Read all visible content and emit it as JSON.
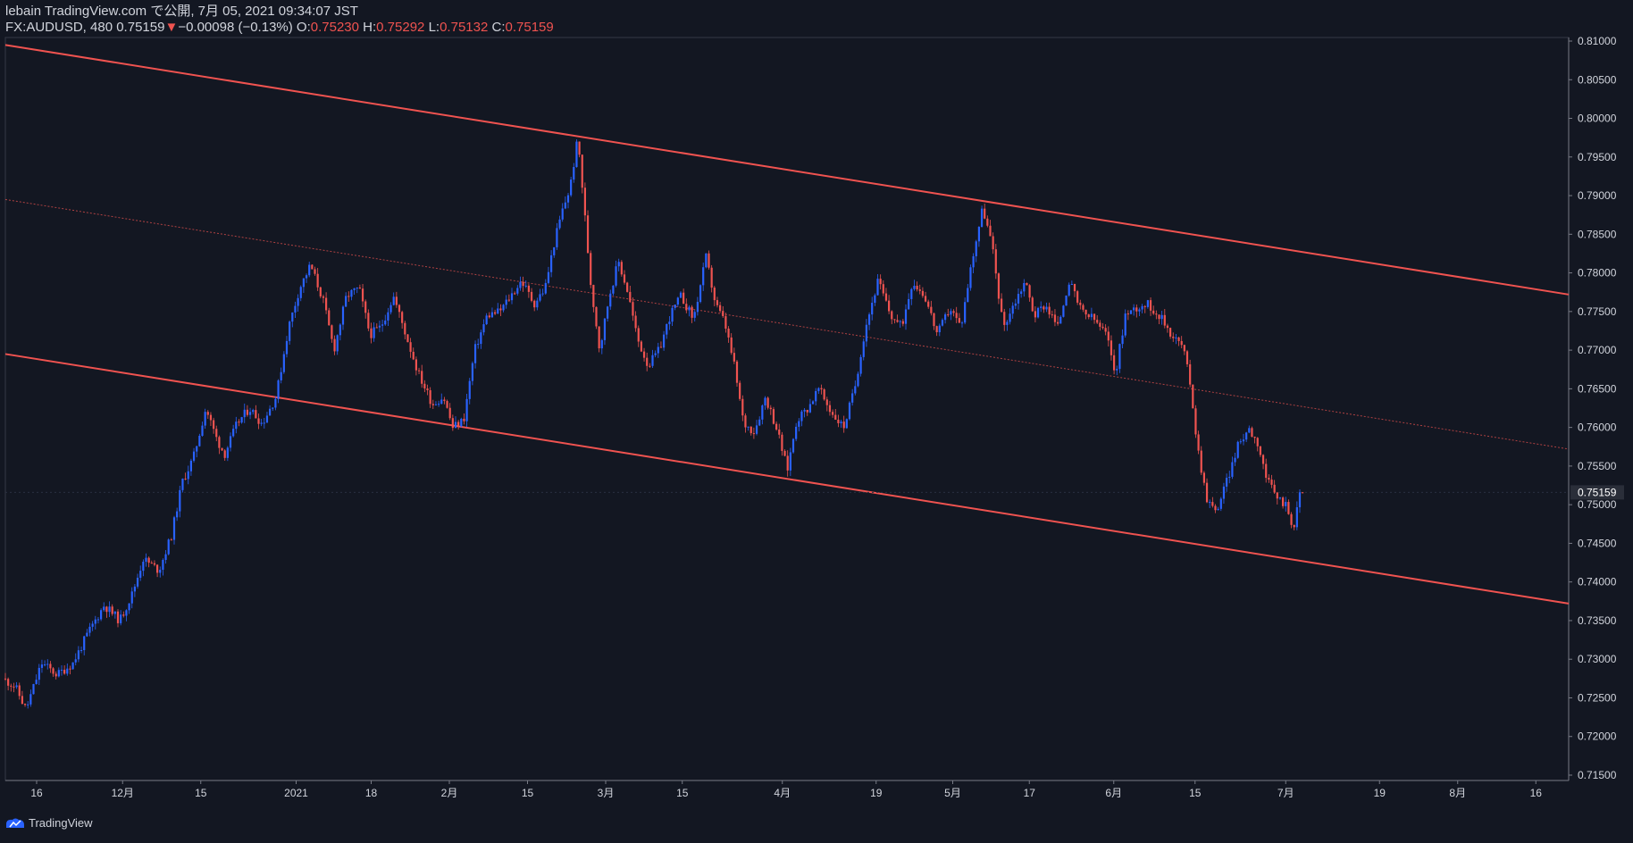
{
  "header": {
    "publisher": "lebain TradingView.com で公開, 7月 05, 2021 09:34:07 JST",
    "symbol": "FX:AUDUSD, 480",
    "last": "0.75159",
    "change_arrow": "▼",
    "change": "−0.00098 (−0.13%)",
    "o_label": "O:",
    "o_value": "0.75230",
    "h_label": "H:",
    "h_value": "0.75292",
    "l_label": "L:",
    "l_value": "0.75132",
    "c_label": "C:",
    "c_value": "0.75159"
  },
  "footer": {
    "brand": "TradingView"
  },
  "colors": {
    "background": "#131722",
    "up": "#2962ff",
    "down": "#ef5350",
    "channel": "#f05350",
    "text": "#d1d4dc",
    "grid": "#363a45"
  },
  "chart_data": {
    "type": "candlestick",
    "ylim": [
      0.715,
      0.81
    ],
    "y_ticks": [
      "0.81000",
      "0.80500",
      "0.80000",
      "0.79500",
      "0.79000",
      "0.78500",
      "0.78000",
      "0.77500",
      "0.77000",
      "0.76500",
      "0.76000",
      "0.75500",
      "0.75000",
      "0.74500",
      "0.74000",
      "0.73500",
      "0.73000",
      "0.72500",
      "0.72000",
      "0.71500"
    ],
    "last_price": {
      "value": 0.75159,
      "label": "0.75159"
    },
    "x_ticks": [
      {
        "label": "16",
        "t": 0.02
      },
      {
        "label": "12月",
        "t": 0.075
      },
      {
        "label": "15",
        "t": 0.125
      },
      {
        "label": "2021",
        "t": 0.186
      },
      {
        "label": "18",
        "t": 0.234
      },
      {
        "label": "2月",
        "t": 0.284
      },
      {
        "label": "15",
        "t": 0.334
      },
      {
        "label": "3月",
        "t": 0.384
      },
      {
        "label": "15",
        "t": 0.433
      },
      {
        "label": "4月",
        "t": 0.497
      },
      {
        "label": "19",
        "t": 0.557
      },
      {
        "label": "5月",
        "t": 0.606
      },
      {
        "label": "17",
        "t": 0.655
      },
      {
        "label": "6月",
        "t": 0.709
      },
      {
        "label": "15",
        "t": 0.761
      },
      {
        "label": "7月",
        "t": 0.819
      },
      {
        "label": "19",
        "t": 0.879
      },
      {
        "label": "8月",
        "t": 0.929
      },
      {
        "label": "16",
        "t": 0.979
      }
    ],
    "price_path": [
      [
        0.0,
        0.7275
      ],
      [
        0.008,
        0.7265
      ],
      [
        0.015,
        0.7235
      ],
      [
        0.025,
        0.7295
      ],
      [
        0.035,
        0.728
      ],
      [
        0.045,
        0.7295
      ],
      [
        0.055,
        0.7335
      ],
      [
        0.065,
        0.737
      ],
      [
        0.075,
        0.735
      ],
      [
        0.083,
        0.7385
      ],
      [
        0.09,
        0.743
      ],
      [
        0.1,
        0.7415
      ],
      [
        0.108,
        0.746
      ],
      [
        0.115,
        0.753
      ],
      [
        0.122,
        0.756
      ],
      [
        0.13,
        0.7625
      ],
      [
        0.137,
        0.7585
      ],
      [
        0.142,
        0.7565
      ],
      [
        0.15,
        0.7605
      ],
      [
        0.158,
        0.7625
      ],
      [
        0.166,
        0.7605
      ],
      [
        0.175,
        0.764
      ],
      [
        0.183,
        0.773
      ],
      [
        0.19,
        0.778
      ],
      [
        0.197,
        0.781
      ],
      [
        0.205,
        0.7765
      ],
      [
        0.212,
        0.77
      ],
      [
        0.22,
        0.777
      ],
      [
        0.228,
        0.778
      ],
      [
        0.235,
        0.772
      ],
      [
        0.242,
        0.773
      ],
      [
        0.25,
        0.777
      ],
      [
        0.258,
        0.772
      ],
      [
        0.266,
        0.767
      ],
      [
        0.275,
        0.763
      ],
      [
        0.282,
        0.764
      ],
      [
        0.288,
        0.76
      ],
      [
        0.295,
        0.761
      ],
      [
        0.302,
        0.77
      ],
      [
        0.31,
        0.7745
      ],
      [
        0.318,
        0.775
      ],
      [
        0.325,
        0.777
      ],
      [
        0.332,
        0.779
      ],
      [
        0.34,
        0.776
      ],
      [
        0.347,
        0.778
      ],
      [
        0.353,
        0.784
      ],
      [
        0.358,
        0.788
      ],
      [
        0.363,
        0.791
      ],
      [
        0.368,
        0.7975
      ],
      [
        0.372,
        0.7885
      ],
      [
        0.376,
        0.779
      ],
      [
        0.382,
        0.77
      ],
      [
        0.388,
        0.777
      ],
      [
        0.394,
        0.7815
      ],
      [
        0.4,
        0.7775
      ],
      [
        0.406,
        0.7715
      ],
      [
        0.413,
        0.768
      ],
      [
        0.42,
        0.77
      ],
      [
        0.427,
        0.7745
      ],
      [
        0.434,
        0.777
      ],
      [
        0.442,
        0.774
      ],
      [
        0.45,
        0.782
      ],
      [
        0.456,
        0.776
      ],
      [
        0.462,
        0.7735
      ],
      [
        0.468,
        0.768
      ],
      [
        0.474,
        0.7605
      ],
      [
        0.481,
        0.7595
      ],
      [
        0.488,
        0.764
      ],
      [
        0.495,
        0.76
      ],
      [
        0.502,
        0.7545
      ],
      [
        0.508,
        0.761
      ],
      [
        0.515,
        0.7625
      ],
      [
        0.522,
        0.765
      ],
      [
        0.53,
        0.762
      ],
      [
        0.538,
        0.76
      ],
      [
        0.545,
        0.765
      ],
      [
        0.552,
        0.773
      ],
      [
        0.56,
        0.779
      ],
      [
        0.568,
        0.7745
      ],
      [
        0.575,
        0.773
      ],
      [
        0.582,
        0.779
      ],
      [
        0.59,
        0.777
      ],
      [
        0.598,
        0.772
      ],
      [
        0.606,
        0.7755
      ],
      [
        0.613,
        0.773
      ],
      [
        0.62,
        0.7815
      ],
      [
        0.627,
        0.7885
      ],
      [
        0.633,
        0.7835
      ],
      [
        0.64,
        0.773
      ],
      [
        0.647,
        0.776
      ],
      [
        0.654,
        0.779
      ],
      [
        0.66,
        0.7745
      ],
      [
        0.667,
        0.776
      ],
      [
        0.675,
        0.773
      ],
      [
        0.682,
        0.779
      ],
      [
        0.69,
        0.775
      ],
      [
        0.698,
        0.774
      ],
      [
        0.706,
        0.772
      ],
      [
        0.712,
        0.767
      ],
      [
        0.718,
        0.7745
      ],
      [
        0.725,
        0.7755
      ],
      [
        0.732,
        0.776
      ],
      [
        0.74,
        0.7745
      ],
      [
        0.748,
        0.772
      ],
      [
        0.755,
        0.7705
      ],
      [
        0.76,
        0.7655
      ],
      [
        0.764,
        0.758
      ],
      [
        0.77,
        0.751
      ],
      [
        0.776,
        0.749
      ],
      [
        0.783,
        0.753
      ],
      [
        0.79,
        0.7575
      ],
      [
        0.797,
        0.76
      ],
      [
        0.803,
        0.758
      ],
      [
        0.809,
        0.753
      ],
      [
        0.815,
        0.751
      ],
      [
        0.821,
        0.75
      ],
      [
        0.826,
        0.747
      ],
      [
        0.83,
        0.7516
      ]
    ],
    "channel": {
      "upper": [
        [
          0,
          0.8095
        ],
        [
          1,
          0.7772
        ]
      ],
      "lower": [
        [
          0,
          0.7695
        ],
        [
          1,
          0.7372
        ]
      ],
      "mid": [
        [
          0,
          0.7895
        ],
        [
          1,
          0.7572
        ]
      ]
    }
  }
}
